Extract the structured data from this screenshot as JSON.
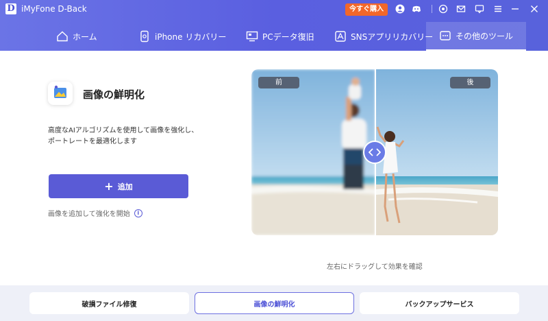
{
  "app": {
    "logo_letter": "D",
    "title": "iMyFone D-Back",
    "buy_label": "今すぐ購入"
  },
  "titlebar_icons": [
    "user-icon",
    "discord-icon",
    "theme-icon",
    "mail-icon",
    "feedback-icon",
    "menu-icon",
    "minimize-icon",
    "close-icon"
  ],
  "nav": {
    "tabs": [
      {
        "label": "ホーム",
        "icon": "home-icon"
      },
      {
        "label": "iPhone リカバリー",
        "icon": "phone-icon"
      },
      {
        "label": "PCデータ復旧",
        "icon": "pc-icon"
      },
      {
        "label": "SNSアプリリカバリー",
        "icon": "apps-icon"
      },
      {
        "label": "その他のツール",
        "icon": "more-tools-icon",
        "active": true
      }
    ]
  },
  "feature": {
    "title": "画像の鮮明化",
    "desc_line1": "高度なAIアルゴリズムを使用して画像を強化し、",
    "desc_line2": "ポートレートを最適化します",
    "add_label": "追加",
    "hint": "画像を追加して強化を開始"
  },
  "compare": {
    "before_label": "前",
    "after_label": "後",
    "drag_hint": "左右にドラッグして効果を確認"
  },
  "bottom": {
    "buttons": [
      {
        "label": "破損ファイル修復"
      },
      {
        "label": "画像の鮮明化",
        "active": true
      },
      {
        "label": "バックアップサービス"
      }
    ]
  },
  "colors": {
    "header": "#5a5fe0",
    "accent": "#5a5bd6",
    "buy": "#f2672a",
    "bottom_bg": "#eef0f8"
  }
}
